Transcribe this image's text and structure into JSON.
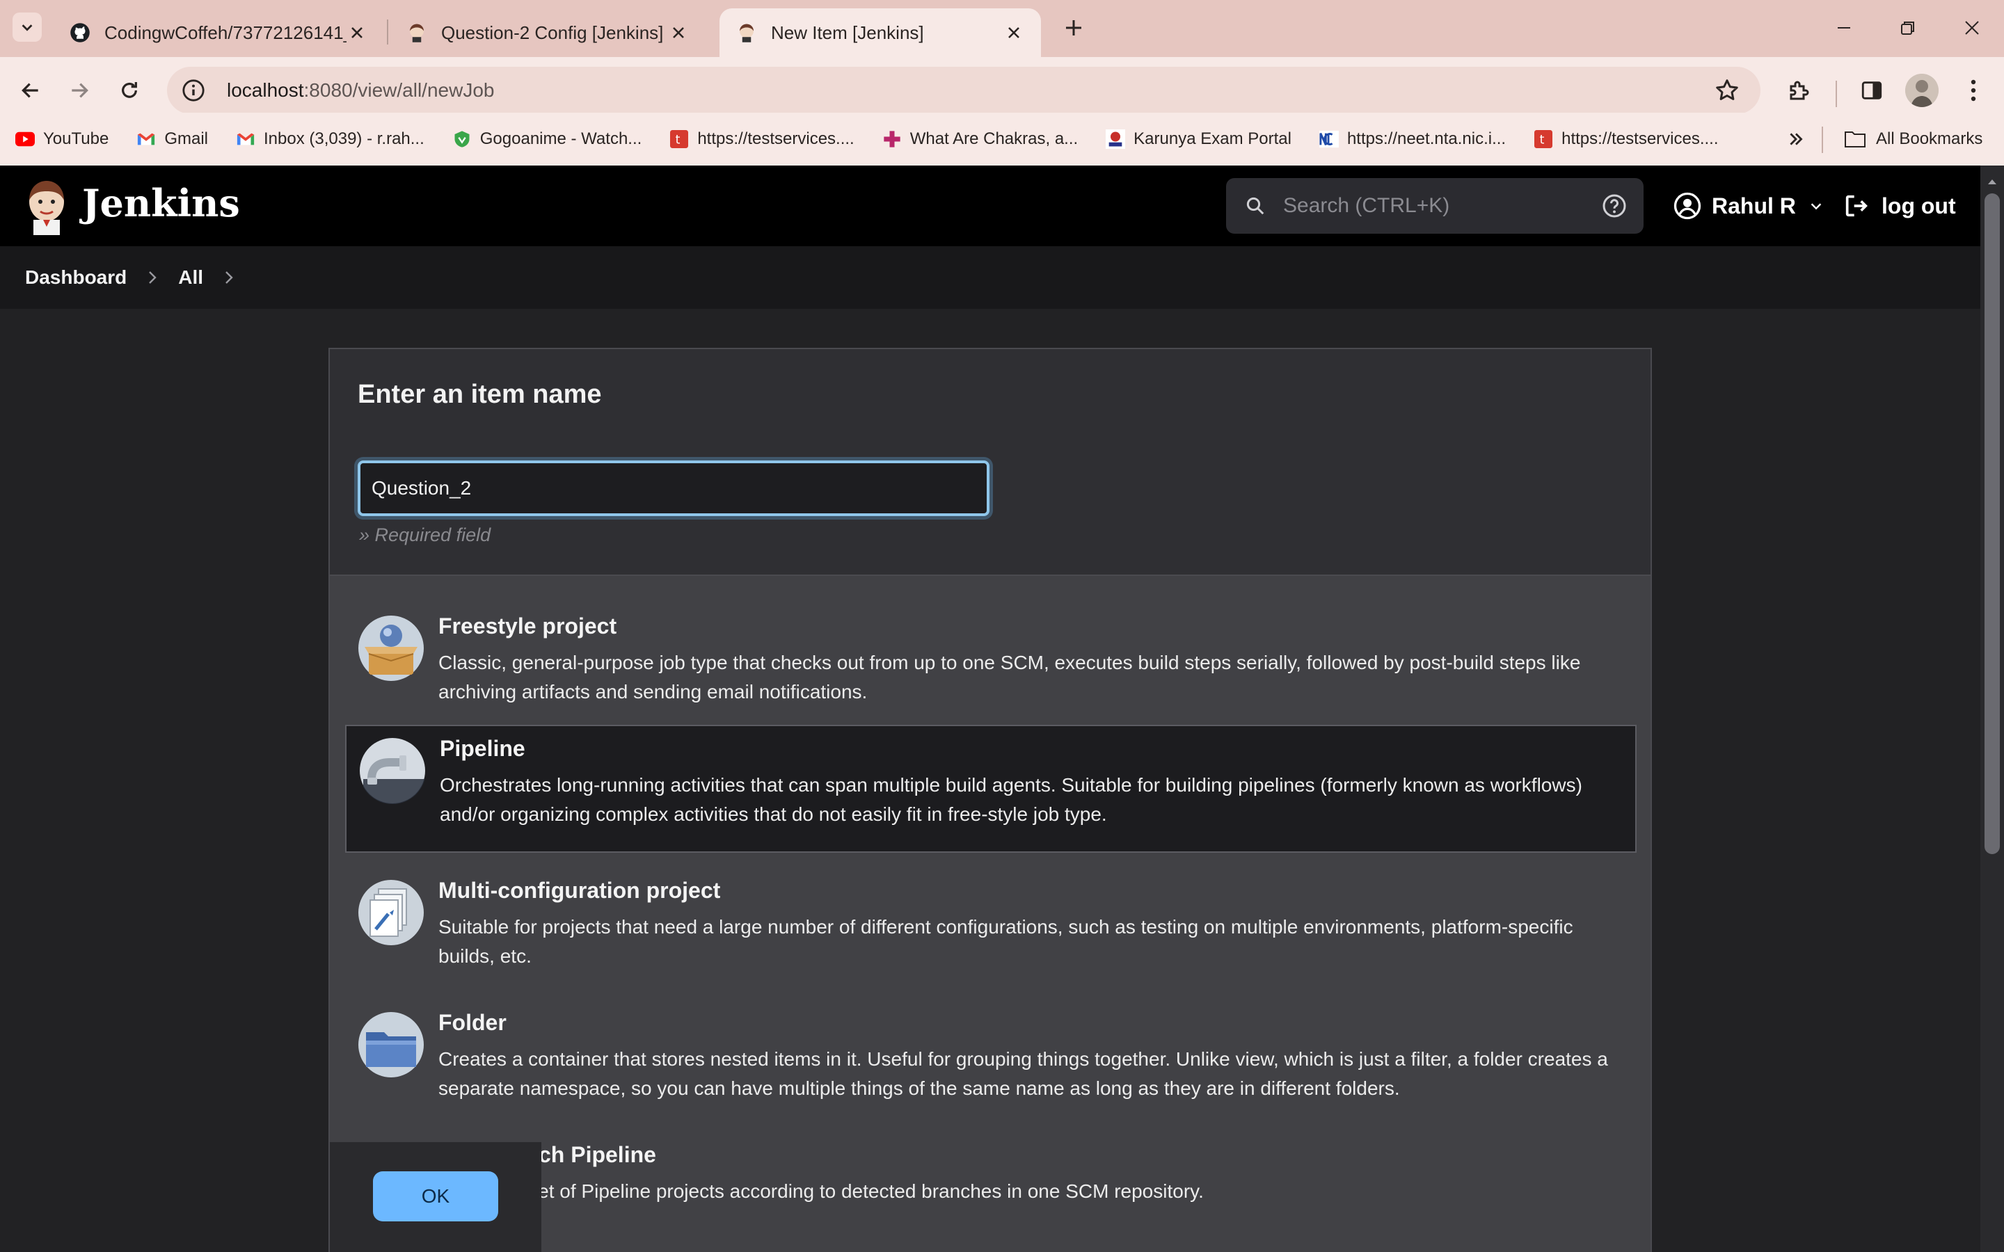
{
  "browser": {
    "tabs": [
      {
        "title": "CodingwCoffeh/73772126141_I",
        "icon": "github-icon"
      },
      {
        "title": "Question-2 Config [Jenkins]",
        "icon": "jenkins-icon"
      },
      {
        "title": "New Item [Jenkins]",
        "icon": "jenkins-icon",
        "active": true
      }
    ],
    "url_host": "localhost",
    "url_path": ":8080/view/all/newJob",
    "bookmarks": [
      {
        "label": "YouTube",
        "icon": "youtube-icon"
      },
      {
        "label": "Gmail",
        "icon": "gmail-icon"
      },
      {
        "label": "Inbox (3,039) - r.rah...",
        "icon": "gmail-icon"
      },
      {
        "label": "Gogoanime - Watch...",
        "icon": "gogoanime-icon"
      },
      {
        "label": "https://testservices....",
        "icon": "testservices-icon"
      },
      {
        "label": "What Are Chakras, a...",
        "icon": "plus-cross-icon"
      },
      {
        "label": "Karunya Exam Portal",
        "icon": "karunya-icon"
      },
      {
        "label": "https://neet.nta.nic.i...",
        "icon": "nic-icon"
      },
      {
        "label": "https://testservices....",
        "icon": "testservices-icon"
      }
    ],
    "all_bookmarks": "All Bookmarks"
  },
  "jenkins": {
    "brand": "Jenkins",
    "search_placeholder": "Search (CTRL+K)",
    "user": "Rahul R",
    "logout": "log out",
    "breadcrumb": [
      "Dashboard",
      "All"
    ]
  },
  "form": {
    "title": "Enter an item name",
    "item_name": "Question_2",
    "required": "» Required field",
    "ok_label": "OK"
  },
  "item_types": [
    {
      "name": "Freestyle project",
      "desc": "Classic, general-purpose job type that checks out from up to one SCM, executes build steps serially, followed by post-build steps like archiving artifacts and sending email notifications."
    },
    {
      "name": "Pipeline",
      "desc": "Orchestrates long-running activities that can span multiple build agents. Suitable for building pipelines (formerly known as workflows) and/or organizing complex activities that do not easily fit in free-style job type.",
      "selected": true
    },
    {
      "name": "Multi-configuration project",
      "desc": "Suitable for projects that need a large number of different configurations, such as testing on multiple environments, platform-specific builds, etc."
    },
    {
      "name": "Folder",
      "desc": "Creates a container that stores nested items in it. Useful for grouping things together. Unlike view, which is just a filter, a folder creates a separate namespace, so you can have multiple things of the same name as long as they are in different folders."
    },
    {
      "name": "Multibranch Pipeline",
      "desc": "Creates a set of Pipeline projects according to detected branches in one SCM repository."
    }
  ],
  "colors": {
    "accent": "#6cb8ff",
    "header": "#000000",
    "chrome": "#e6c6c0"
  }
}
